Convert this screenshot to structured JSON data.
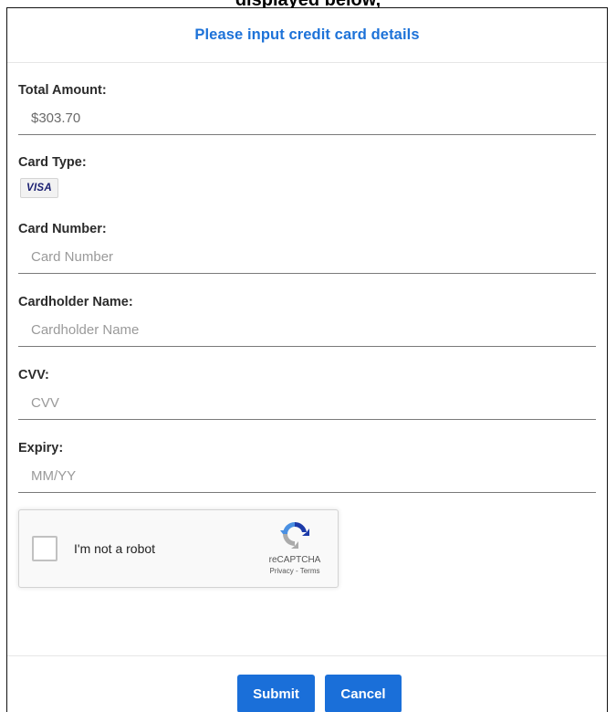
{
  "top_clipped_text": "displayed below,",
  "header": {
    "title": "Please input credit card details"
  },
  "fields": {
    "total_amount": {
      "label": "Total Amount:",
      "value": "$303.70"
    },
    "card_type": {
      "label": "Card Type:",
      "badge": "VISA"
    },
    "card_number": {
      "label": "Card Number:",
      "placeholder": "Card Number"
    },
    "cardholder_name": {
      "label": "Cardholder Name:",
      "placeholder": "Cardholder Name"
    },
    "cvv": {
      "label": "CVV:",
      "placeholder": "CVV"
    },
    "expiry": {
      "label": "Expiry:",
      "placeholder": "MM/YY"
    }
  },
  "captcha": {
    "label": "I'm not a robot",
    "brand": "reCAPTCHA",
    "links": "Privacy - Terms",
    "icon": "recaptcha-icon"
  },
  "buttons": {
    "submit": "Submit",
    "cancel": "Cancel"
  },
  "colors": {
    "accent": "#1d72d8",
    "button": "#1a6fd9",
    "visa": "#1a1f71"
  }
}
